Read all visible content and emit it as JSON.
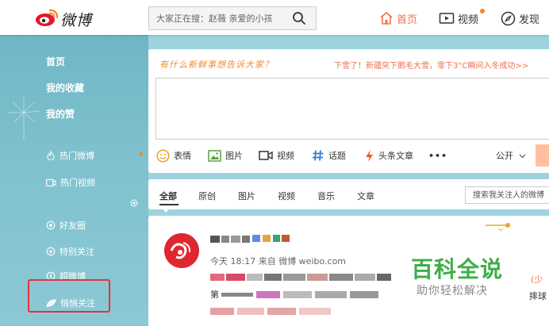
{
  "header": {
    "logo_text": "微博",
    "search_placeholder": "大家正在搜：赵薇 亲爱的小孩",
    "nav": [
      {
        "label": "首页",
        "icon": "home-icon",
        "active": true
      },
      {
        "label": "视频",
        "icon": "video-icon",
        "has_dot": true
      },
      {
        "label": "发现",
        "icon": "compass-icon"
      }
    ]
  },
  "sidebar": {
    "items": [
      {
        "label": "首页"
      },
      {
        "label": "我的收藏"
      },
      {
        "label": "我的赞"
      },
      {
        "label": "热门微博",
        "icon": "flame-icon",
        "has_dot": true
      },
      {
        "label": "热门视频",
        "icon": "video-icon"
      },
      {
        "label": "好友圈",
        "icon": "circle-icon"
      },
      {
        "label": "特别关注",
        "icon": "star-icon"
      },
      {
        "label": "超微博",
        "icon": "badge-icon"
      },
      {
        "label": "悄悄关注",
        "icon": "leaf-icon",
        "highlighted": true
      }
    ]
  },
  "composer": {
    "prompt": "有什么新鲜事想告诉大家？",
    "hot_topic": "下雪了！新疆突下鹅毛大雪，零下3°C瞬间入冬成功>>",
    "tools": [
      {
        "label": "表情",
        "icon": "emoji-icon"
      },
      {
        "label": "图片",
        "icon": "image-icon"
      },
      {
        "label": "视频",
        "icon": "video-icon"
      },
      {
        "label": "话题",
        "icon": "hashtag-icon"
      },
      {
        "label": "头条文章",
        "icon": "lightning-icon"
      }
    ],
    "more_label": "•••",
    "visibility": "公开",
    "accent": "#f08b30"
  },
  "feed": {
    "tabs": [
      "全部",
      "原创",
      "图片",
      "视频",
      "音乐",
      "文章"
    ],
    "active_tab": "全部",
    "search_placeholder": "搜索我关注人的微博"
  },
  "post": {
    "meta": "今天 18:17 来自 微博 weibo.com",
    "line2_prefix": "第",
    "right_snip1": "(少",
    "right_snip2": "摔球"
  },
  "watermark": {
    "title": "百科全说",
    "subtitle": "助你轻松解决"
  },
  "colors": {
    "brand_orange": "#eb7350",
    "sidebar_teal": "#7fc1ce",
    "highlight_red": "#e8303f",
    "watermark_green": "#3fae49"
  }
}
